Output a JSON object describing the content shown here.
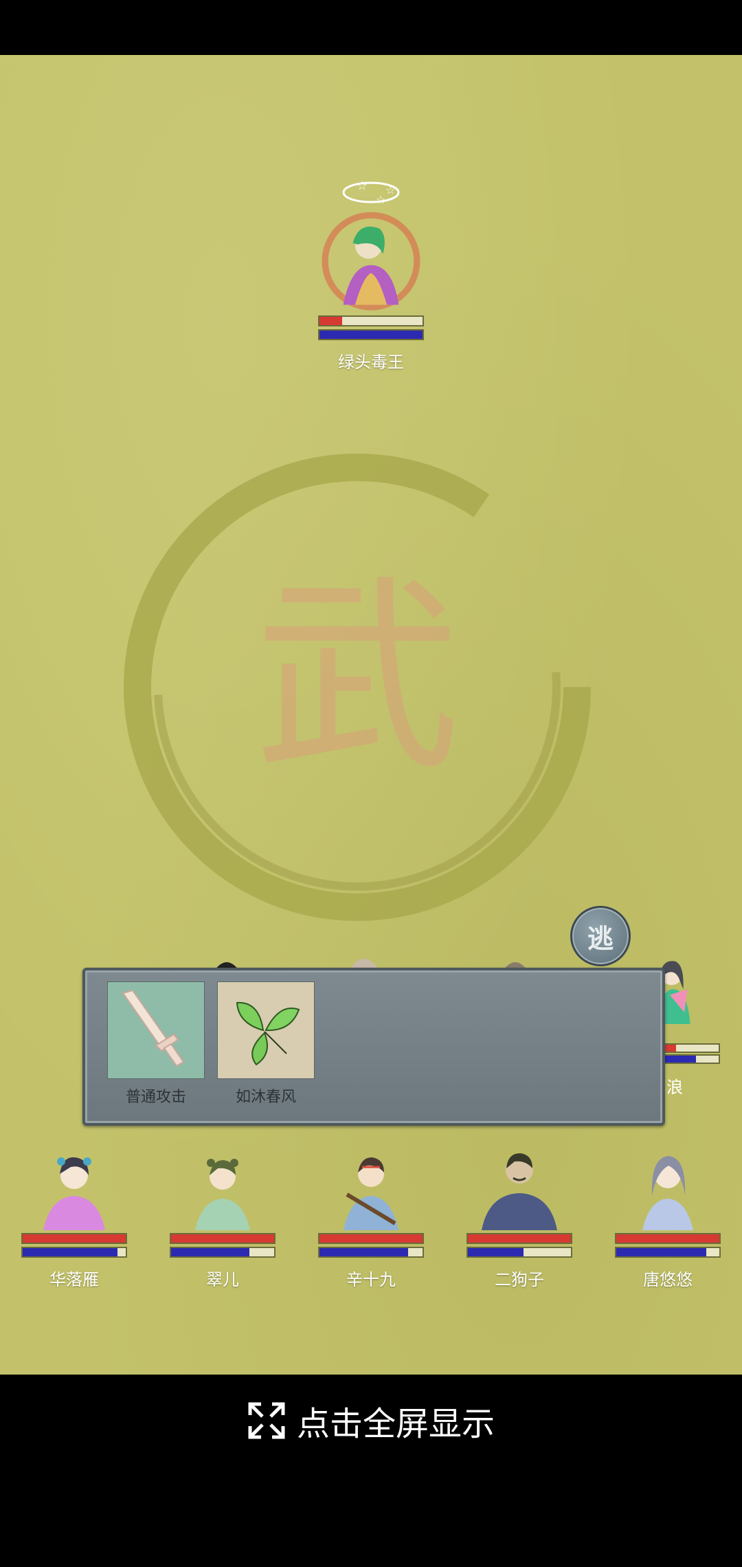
{
  "enemy": {
    "name": "绿头毒王",
    "hp": 0.22,
    "mp": 1.0,
    "status_icon": "dizzy-stars-icon"
  },
  "emblem_character": "武",
  "flee_button": {
    "label": "逃"
  },
  "skills": [
    {
      "name": "普通攻击",
      "icon": "sword-icon"
    },
    {
      "name": "如沐春风",
      "icon": "leaf-icon"
    }
  ],
  "hidden_ally_partial_name": "郎浪",
  "party": [
    {
      "name": "华落雁",
      "hp": 1.0,
      "mp": 0.92
    },
    {
      "name": "翠儿",
      "hp": 1.0,
      "mp": 0.76
    },
    {
      "name": "辛十九",
      "hp": 1.0,
      "mp": 0.86
    },
    {
      "name": "二狗子",
      "hp": 1.0,
      "mp": 0.54
    },
    {
      "name": "唐悠悠",
      "hp": 1.0,
      "mp": 0.87
    }
  ],
  "fullscreen": {
    "label": "点击全屏显示",
    "icon": "expand-icon"
  },
  "colors": {
    "background": "#c3c26a",
    "hp": "#d63a32",
    "mp": "#2c2ab0"
  }
}
